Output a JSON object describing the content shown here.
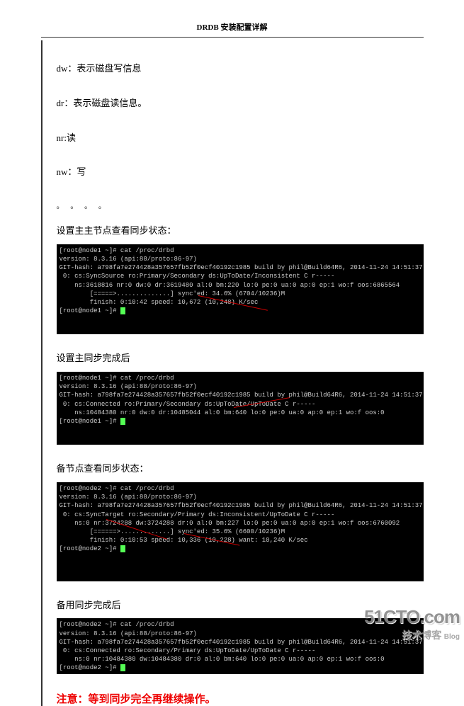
{
  "header": {
    "title": "DRDB 安装配置详解"
  },
  "lines": {
    "dw": "dw：表示磁盘写信息",
    "dr": "dr：表示磁盘读信息。",
    "nr": "nr:读",
    "nw": "nw：写",
    "dots": "。  。  。  。"
  },
  "section1": {
    "title": "设置主主节点查看同步状态：",
    "terminal": "[root@node1 ~]# cat /proc/drbd\nversion: 8.3.16 (api:88/proto:86-97)\nGIT-hash: a798fa7e274428a357657fb52f0ecf40192c1985 build by phil@Build64R6, 2014-11-24 14:51:37\n 0: cs:SyncSource ro:Primary/Secondary ds:UpToDate/Inconsistent C r-----\n    ns:3618816 nr:0 dw:0 dr:3619480 al:0 bm:220 lo:0 pe:0 ua:0 ap:0 ep:1 wo:f oos:6865564\n        [=====>..............] sync'ed: 34.6% (6704/10236)M\n        finish: 0:10:42 speed: 10,672 (10,248) K/sec\n[root@node1 ~]# "
  },
  "section2": {
    "title": "设置主同步完成后",
    "terminal": "[root@node1 ~]# cat /proc/drbd\nversion: 8.3.16 (api:88/proto:86-97)\nGIT-hash: a798fa7e274428a357657fb52f0ecf40192c1985 build by phil@Build64R6, 2014-11-24 14:51:37\n 0: cs:Connected ro:Primary/Secondary ds:UpToDate/UpToDate C r-----\n    ns:10484380 nr:0 dw:0 dr:10485044 al:0 bm:640 lo:0 pe:0 ua:0 ap:0 ep:1 wo:f oos:0\n[root@node1 ~]# "
  },
  "section3": {
    "title": "备节点查看同步状态：",
    "terminal": "[root@node2 ~]# cat /proc/drbd\nversion: 8.3.16 (api:88/proto:86-97)\nGIT-hash: a798fa7e274428a357657fb52f0ecf40192c1985 build by phil@Build64R6, 2014-11-24 14:51:37\n 0: cs:SyncTarget ro:Secondary/Primary ds:Inconsistent/UpToDate C r-----\n    ns:0 nr:3724288 dw:3724288 dr:0 al:0 bm:227 lo:0 pe:0 ua:0 ap:0 ep:1 wo:f oos:6760092\n        [======>.............] sync'ed: 35.6% (6600/10236)M\n        finish: 0:10:53 speed: 10,336 (10,228) want: 10,240 K/sec\n[root@node2 ~]# "
  },
  "section4": {
    "title": "备用同步完成后",
    "terminal": "[root@node2 ~]# cat /proc/drbd\nversion: 8.3.16 (api:88/proto:86-97)\nGIT-hash: a798fa7e274428a357657fb52f0ecf40192c1985 build by phil@Build64R6, 2014-11-24 14:51:37\n 0: cs:Connected ro:Secondary/Primary ds:UpToDate/UpToDate C r-----\n    ns:0 nr:10484380 dw:10484380 dr:0 al:0 bm:640 lo:0 pe:0 ua:0 ap:0 ep:1 wo:f oos:0\n[root@node2 ~]# "
  },
  "warning": "注意：等到同步完全再继续操作。",
  "watermark": {
    "main": "51CTO.com",
    "sub": "技术博客",
    "small": "Blog"
  }
}
